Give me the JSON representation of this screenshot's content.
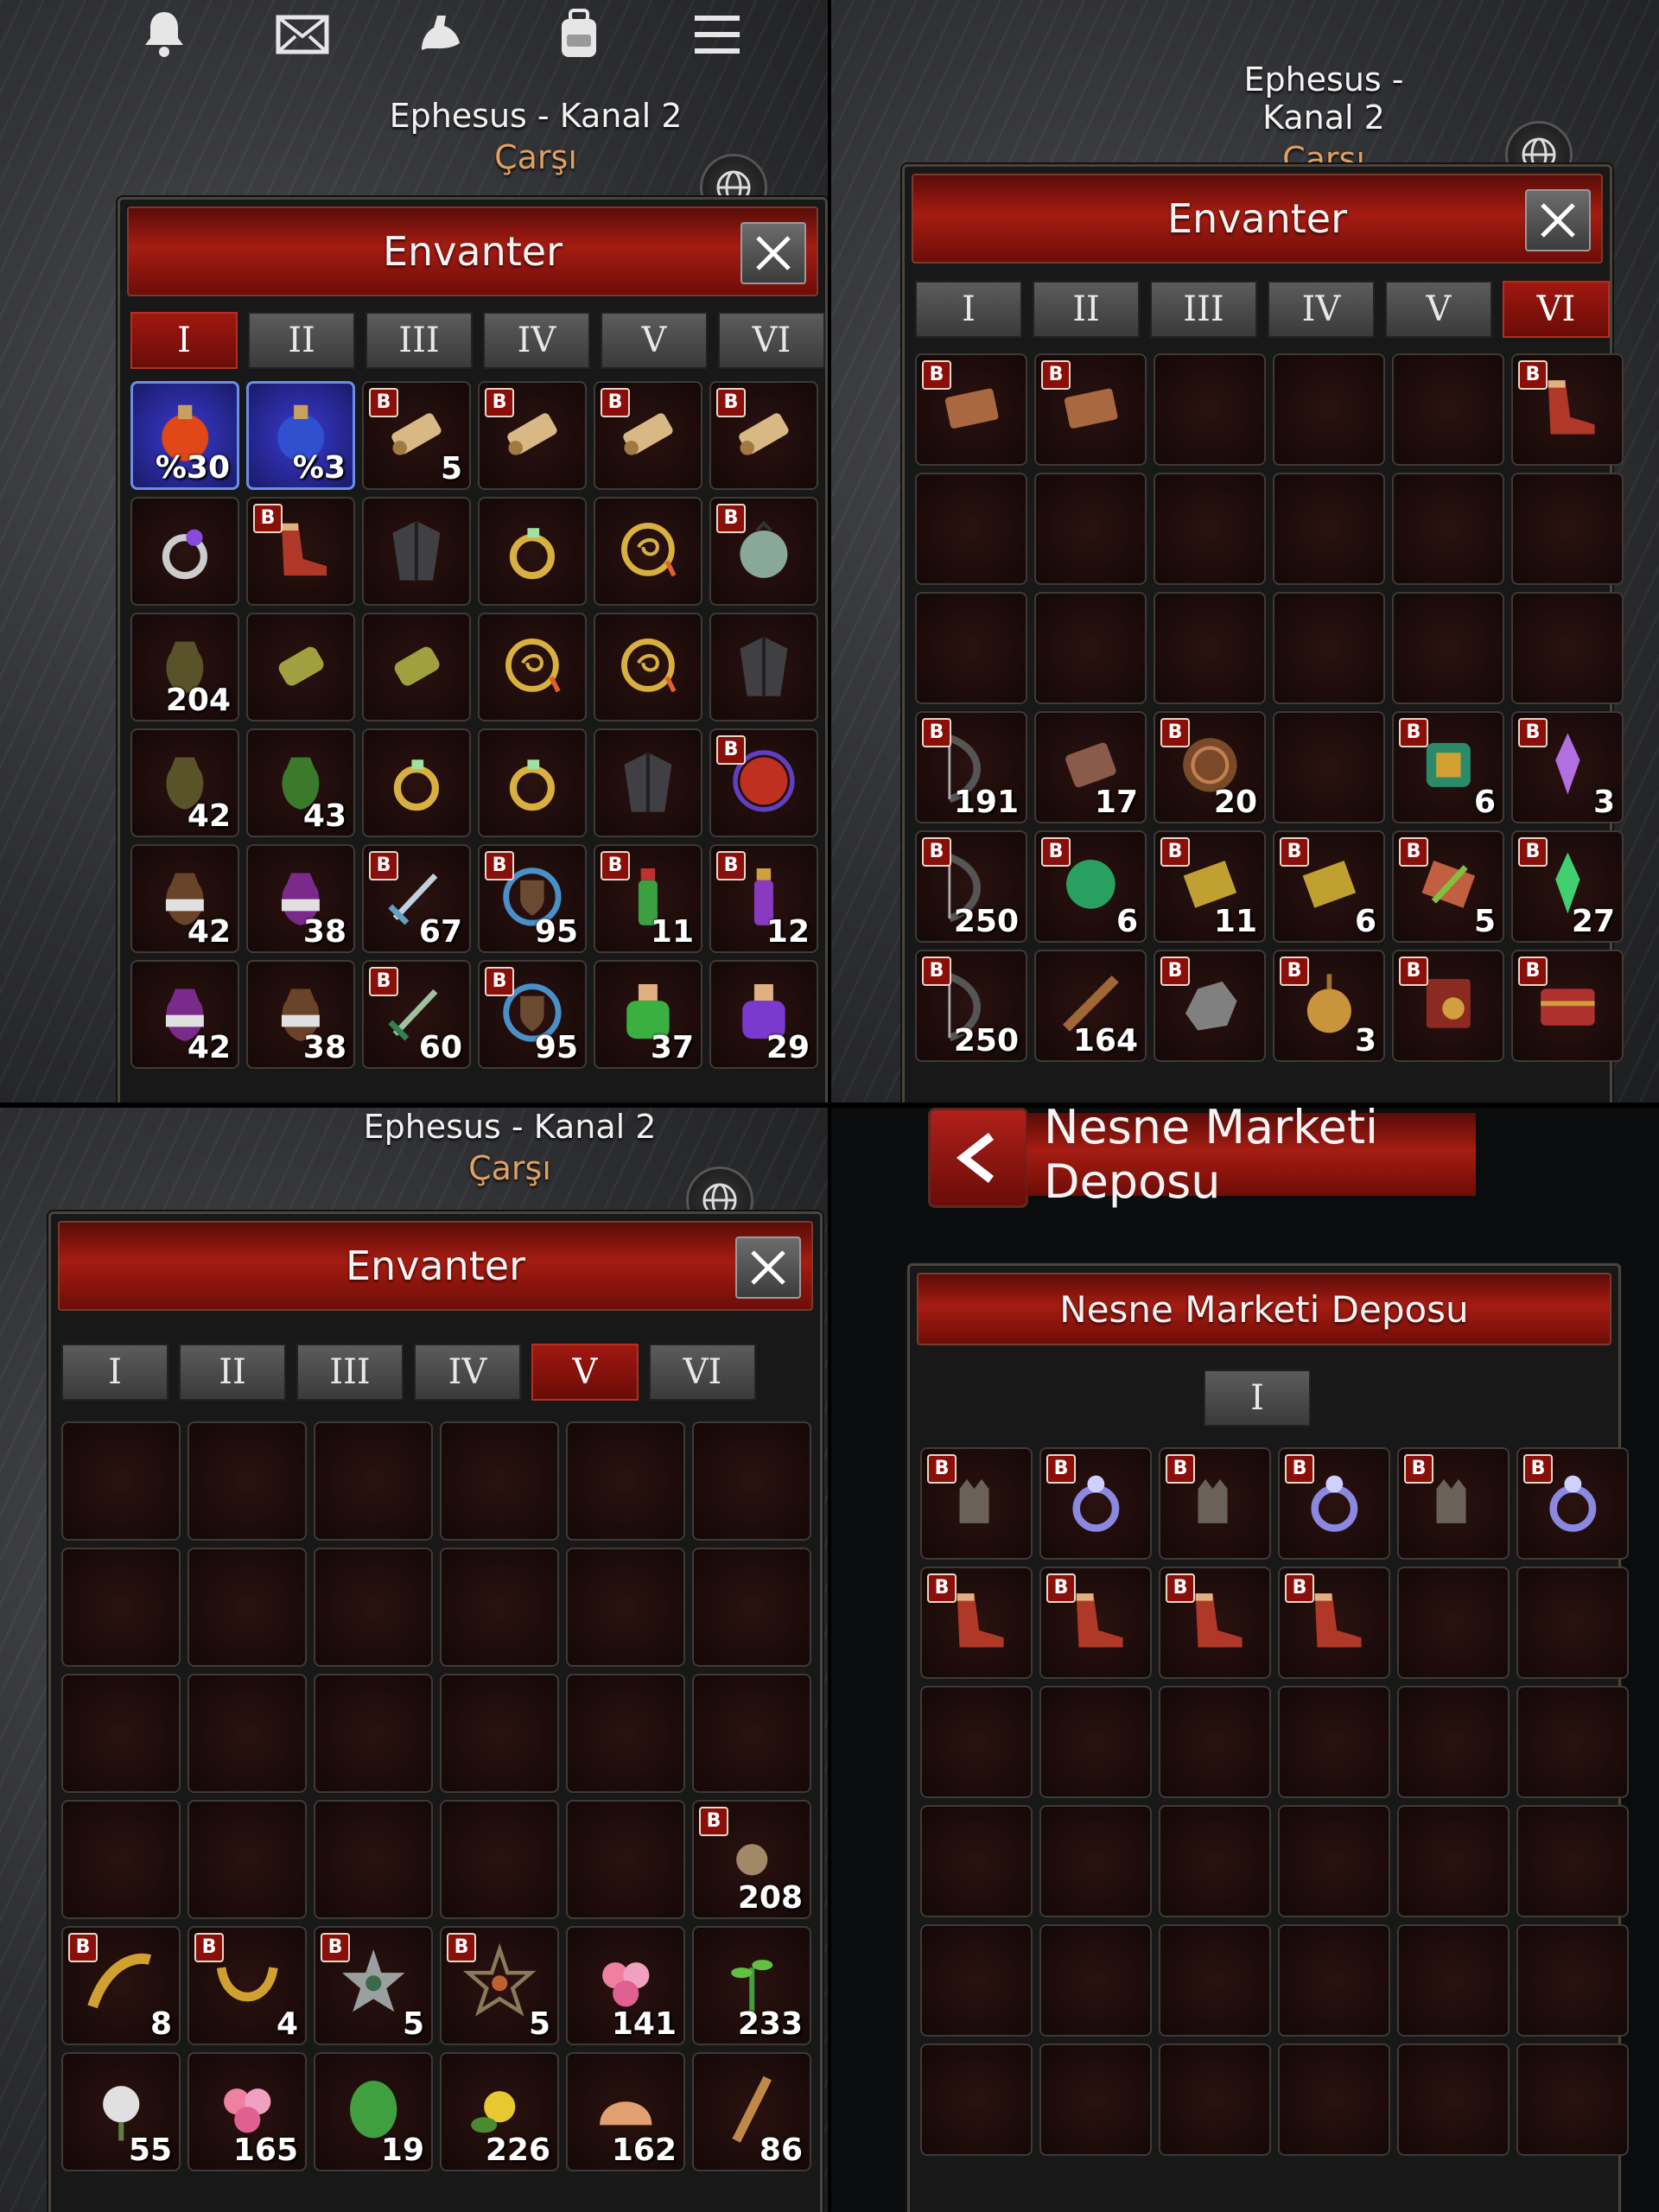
{
  "top_icons": [
    "bell-icon",
    "mail-icon",
    "strength-icon",
    "backpack-icon",
    "menu-icon"
  ],
  "location": {
    "city": "Ephesus - Kanal 2",
    "zone": "Çarşı"
  },
  "inventory": {
    "title": "Envanter",
    "tabs": [
      "I",
      "II",
      "III",
      "IV",
      "V",
      "VI"
    ]
  },
  "panel1": {
    "active_tab": 0,
    "slots": [
      {
        "icon": "red-potion",
        "qty": "%30",
        "sel": true
      },
      {
        "icon": "blue-potion",
        "qty": "%3",
        "sel": true
      },
      {
        "icon": "scroll",
        "qty": "5",
        "b": true
      },
      {
        "icon": "scroll",
        "b": true
      },
      {
        "icon": "scroll",
        "b": true
      },
      {
        "icon": "scroll",
        "b": true
      },
      {
        "icon": "gem-ring"
      },
      {
        "icon": "red-boots",
        "b": true
      },
      {
        "icon": "dark-cloak"
      },
      {
        "icon": "gold-ring"
      },
      {
        "icon": "amulet"
      },
      {
        "icon": "pearl-bag",
        "b": true
      },
      {
        "icon": "olive-jar",
        "qty": "204"
      },
      {
        "icon": "bracer"
      },
      {
        "icon": "bracer"
      },
      {
        "icon": "amulet"
      },
      {
        "icon": "amulet"
      },
      {
        "icon": "dark-cloak"
      },
      {
        "icon": "olive-jar",
        "qty": "42"
      },
      {
        "icon": "green-jar",
        "qty": "43"
      },
      {
        "icon": "gold-ring"
      },
      {
        "icon": "gold-ring"
      },
      {
        "icon": "dark-cloak"
      },
      {
        "icon": "red-orb",
        "b": true
      },
      {
        "icon": "brown-jar",
        "qty": "42"
      },
      {
        "icon": "purple-jar",
        "qty": "38"
      },
      {
        "icon": "sword",
        "qty": "67",
        "b": true
      },
      {
        "icon": "blue-shield",
        "qty": "95",
        "b": true
      },
      {
        "icon": "green-vial",
        "qty": "11",
        "b": true
      },
      {
        "icon": "purple-vial",
        "qty": "12",
        "b": true
      },
      {
        "icon": "purple-jar",
        "qty": "42"
      },
      {
        "icon": "brown-jar",
        "qty": "38"
      },
      {
        "icon": "green-sword",
        "qty": "60",
        "b": true
      },
      {
        "icon": "blue-shield",
        "qty": "95",
        "b": true
      },
      {
        "icon": "green-flask",
        "qty": "37"
      },
      {
        "icon": "purple-flask",
        "qty": "29"
      }
    ]
  },
  "panel2": {
    "active_tab": 5,
    "slots": [
      {
        "icon": "book",
        "b": true
      },
      {
        "icon": "book",
        "b": true
      },
      {},
      {},
      {},
      {
        "icon": "red-boots",
        "b": true
      },
      {},
      {},
      {},
      {},
      {},
      {},
      {},
      {},
      {},
      {},
      {},
      {},
      {
        "icon": "dark-bow",
        "qty": "191",
        "b": true
      },
      {
        "icon": "scroll-case",
        "qty": "17"
      },
      {
        "icon": "bronze-coin",
        "qty": "20",
        "b": true
      },
      {},
      {
        "icon": "colorful-item",
        "qty": "6",
        "b": true
      },
      {
        "icon": "purple-crystal",
        "qty": "3",
        "b": true
      },
      {
        "icon": "dark-bow",
        "qty": "250",
        "b": true
      },
      {
        "icon": "green-orb",
        "qty": "6",
        "b": true
      },
      {
        "icon": "yellow-cloth",
        "qty": "11",
        "b": true
      },
      {
        "icon": "yellow-cloth",
        "qty": "6",
        "b": true
      },
      {
        "icon": "leaf-scroll",
        "qty": "5",
        "b": true
      },
      {
        "icon": "green-crystal",
        "qty": "27",
        "b": true
      },
      {
        "icon": "dark-bow",
        "qty": "250",
        "b": true
      },
      {
        "icon": "wood-stick",
        "qty": "164"
      },
      {
        "icon": "ore",
        "b": true
      },
      {
        "icon": "onion",
        "qty": "3",
        "b": true
      },
      {
        "icon": "red-book",
        "b": true
      },
      {
        "icon": "chest",
        "b": true
      }
    ]
  },
  "panel3": {
    "active_tab": 4,
    "slots": [
      {},
      {},
      {},
      {},
      {},
      {},
      {},
      {},
      {},
      {},
      {},
      {},
      {},
      {},
      {},
      {},
      {},
      {},
      {},
      {},
      {},
      {},
      {},
      {
        "icon": "stone",
        "qty": "208",
        "b": true
      },
      {
        "icon": "gold-horn",
        "qty": "8",
        "b": true
      },
      {
        "icon": "gold-crescent",
        "qty": "4",
        "b": true
      },
      {
        "icon": "silver-star",
        "qty": "5",
        "b": true
      },
      {
        "icon": "pentagram",
        "qty": "5",
        "b": true
      },
      {
        "icon": "pink-flower",
        "qty": "141"
      },
      {
        "icon": "green-sprout",
        "qty": "233"
      },
      {
        "icon": "white-flower",
        "qty": "55"
      },
      {
        "icon": "pink-flower",
        "qty": "165"
      },
      {
        "icon": "green-leaf",
        "qty": "19"
      },
      {
        "icon": "yellow-flower",
        "qty": "226"
      },
      {
        "icon": "shell",
        "qty": "162"
      },
      {
        "icon": "twig",
        "qty": "86"
      }
    ]
  },
  "market": {
    "header": "Nesne Marketi Deposu",
    "title": "Nesne Marketi Deposu",
    "tabs": [
      "I"
    ],
    "slots": [
      {
        "icon": "gauntlet",
        "b": true
      },
      {
        "icon": "silver-ring",
        "b": true
      },
      {
        "icon": "gauntlet",
        "b": true
      },
      {
        "icon": "silver-ring",
        "b": true
      },
      {
        "icon": "gauntlet",
        "b": true
      },
      {
        "icon": "silver-ring",
        "b": true
      },
      {
        "icon": "red-boots",
        "b": true
      },
      {
        "icon": "red-boots",
        "b": true
      },
      {
        "icon": "red-boots",
        "b": true
      },
      {
        "icon": "red-boots",
        "b": true
      },
      {},
      {},
      {},
      {},
      {},
      {},
      {},
      {},
      {},
      {},
      {},
      {},
      {},
      {},
      {},
      {},
      {},
      {},
      {},
      {},
      {},
      {},
      {},
      {},
      {},
      {}
    ]
  },
  "badge_letter": "B",
  "colors": {
    "accent": "#a51c12",
    "slot": "#1b0b0a",
    "badge": "#8a0e0a"
  }
}
